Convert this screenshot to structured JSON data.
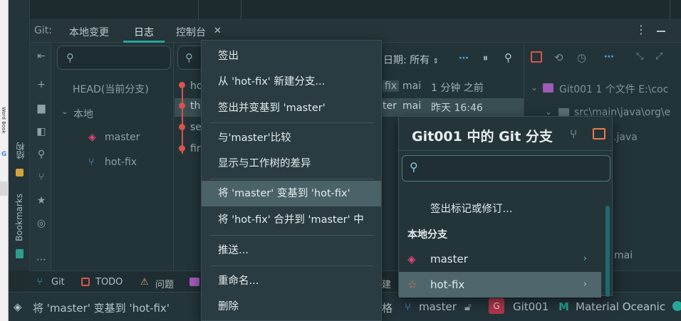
{
  "left_strip": {
    "label": "Word Book"
  },
  "left_toolbar": {
    "structure_label": "结构",
    "bookmarks_label": "Bookmarks"
  },
  "tabs": {
    "prefix": "Git:",
    "items": [
      {
        "label": "本地变更"
      },
      {
        "label": "日志"
      },
      {
        "label": "控制台"
      }
    ]
  },
  "log_toolbar": {
    "date_filter": "日期: 所有"
  },
  "tree": {
    "head": "HEAD(当前分支)",
    "local": "本地",
    "branches": [
      "master",
      "hot-fix"
    ]
  },
  "log": {
    "rows": [
      {
        "short": "ho",
        "branch_tag": "fix",
        "author": "mai",
        "time": "1 分钟 之前"
      },
      {
        "short": "th",
        "branch_tag": "ter",
        "author": "mai",
        "time": "昨天 16:46"
      },
      {
        "short": "se",
        "branch_tag": "",
        "author": "",
        "time": ""
      },
      {
        "short": "fir",
        "branch_tag": "",
        "author": "",
        "time": ""
      }
    ]
  },
  "details": {
    "header": "Git001  1 个文件  E:\\coc",
    "path": "src\\main\\java\\org\\e",
    "file": ".java",
    "author": "mai"
  },
  "context_menu": {
    "items": [
      {
        "label": "签出"
      },
      {
        "label": "从 'hot-fix' 新建分支..."
      },
      {
        "label": "签出并变基到 'master'"
      },
      {
        "label": "与'master'比较"
      },
      {
        "label": "显示与工作树的差异"
      },
      {
        "label": "将 'master' 变基到 'hot-fix'"
      },
      {
        "label": "将 'hot-fix' 合并到 'master' 中"
      },
      {
        "label": "推送..."
      },
      {
        "label": "重命名..."
      },
      {
        "label": "删除"
      }
    ]
  },
  "branches_popup": {
    "title": "Git001 中的 Git 分支",
    "cutoff_text": "…",
    "checkout_tag": "签出标记或修订...",
    "local_header": "本地分支",
    "branches": [
      {
        "name": "master"
      },
      {
        "name": "hot-fix"
      }
    ]
  },
  "bottom_tabs": {
    "items": [
      {
        "label": "Git"
      },
      {
        "label": "TODO"
      },
      {
        "label": "问题"
      }
    ],
    "partial": "建"
  },
  "status_bar": {
    "message": "将 'master' 变基到 'hot-fix'",
    "encoding_fragment": "格",
    "branch": "master",
    "project_badge": "G",
    "project": "Git001",
    "theme": "Material Oceanic"
  },
  "colors": {
    "accent": "#26a69a",
    "tag_pink": "#e8467c",
    "branch_blue": "#5aa9e6",
    "star_orange": "#e87a4f"
  }
}
